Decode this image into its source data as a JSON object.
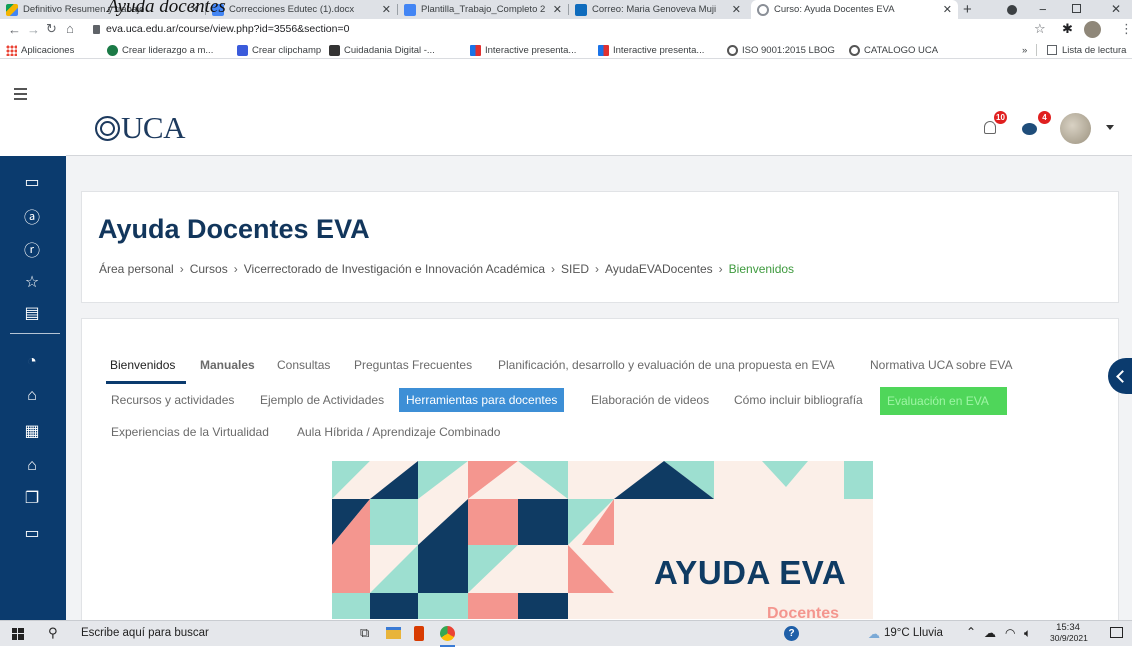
{
  "overlay_caption": "Ayuda docentes",
  "browser": {
    "tabs": [
      {
        "title": "Definitivo Resumen y trabajo",
        "icon_color": "#f4b400",
        "icon": "drive-icon"
      },
      {
        "title": "Correcciones Edutec (1).docx",
        "icon_color": "#4285f4",
        "icon": "docs-icon"
      },
      {
        "title": "Plantilla_Trabajo_Completo 2",
        "icon_color": "#4285f4",
        "icon": "docs-icon"
      },
      {
        "title": "Correo: Maria Genoveva Muji",
        "icon_color": "#0f6cbd",
        "icon": "outlook-icon"
      },
      {
        "title": "Curso: Ayuda Docentes EVA",
        "icon_color": "#8a8f97",
        "icon": "globe-icon"
      }
    ],
    "new_tab": "+",
    "url": "eva.uca.edu.ar/course/view.php?id=3556&section=0",
    "bookmarks": [
      {
        "label": "Aplicaciones",
        "icon": "apps-grid-icon",
        "color": "#1a73e8"
      },
      {
        "label": "Crear liderazgo a m...",
        "icon": "globe-icon",
        "color": "#1b7a46"
      },
      {
        "label": "Crear clipchamp",
        "icon": "clipchamp-icon",
        "color": "#3b5bdb"
      },
      {
        "label": "Cuidadania Digital -...",
        "icon": "photo-icon",
        "color": "#333"
      },
      {
        "label": "Interactive presenta...",
        "icon": "bar-icon",
        "color": "#e03131"
      },
      {
        "label": "Interactive presenta...",
        "icon": "bar-icon",
        "color": "#e03131"
      },
      {
        "label": "ISO 9001:2015 LBOG",
        "icon": "globe-icon",
        "color": "#555"
      },
      {
        "label": "CATALOGO UCA",
        "icon": "globe-icon",
        "color": "#555"
      }
    ],
    "more": "»",
    "reading_list": "Lista de lectura"
  },
  "header": {
    "logo_text": "UCA",
    "notifications_count": "10",
    "messages_count": "4"
  },
  "course": {
    "title": "Ayuda Docentes EVA",
    "breadcrumb": [
      "Área personal",
      "Cursos",
      "Vicerrectorado de Investigación e Innovación Académica",
      "SIED",
      "AyudaEVADocentes",
      "Bienvenidos"
    ]
  },
  "tabs": {
    "row1": [
      "Bienvenidos",
      "Manuales",
      "Consultas",
      "Preguntas Frecuentes",
      "Planificación, desarrollo y evaluación de una propuesta en EVA",
      "Normativa UCA sobre EVA"
    ],
    "row2": [
      "Recursos y actividades",
      "Ejemplo de Actividades",
      "Herramientas para docentes",
      "Elaboración de videos",
      "Cómo incluir bibliografía",
      "Evaluación en EVA"
    ],
    "row3": [
      "Experiencias de la Virtualidad",
      "Aula Híbrida / Aprendizaje Combinado"
    ]
  },
  "banner": {
    "title": "AYUDA EVA",
    "subtitle": "Docentes"
  },
  "taskbar": {
    "search_placeholder": "Escribe aquí para buscar",
    "weather": "19°C Lluvia",
    "time": "15:34",
    "date": "30/9/2021"
  },
  "colors": {
    "sidebar": "#0b3b6e",
    "link_active": "#3e9a3e",
    "tab_blue": "#3d8fd6",
    "tab_green": "#4fd65a",
    "badge_red": "#e02020",
    "banner_navy": "#0f3b63",
    "banner_mint": "#9ddfd0",
    "banner_coral": "#f4968f",
    "banner_cream": "#fbefe8"
  }
}
